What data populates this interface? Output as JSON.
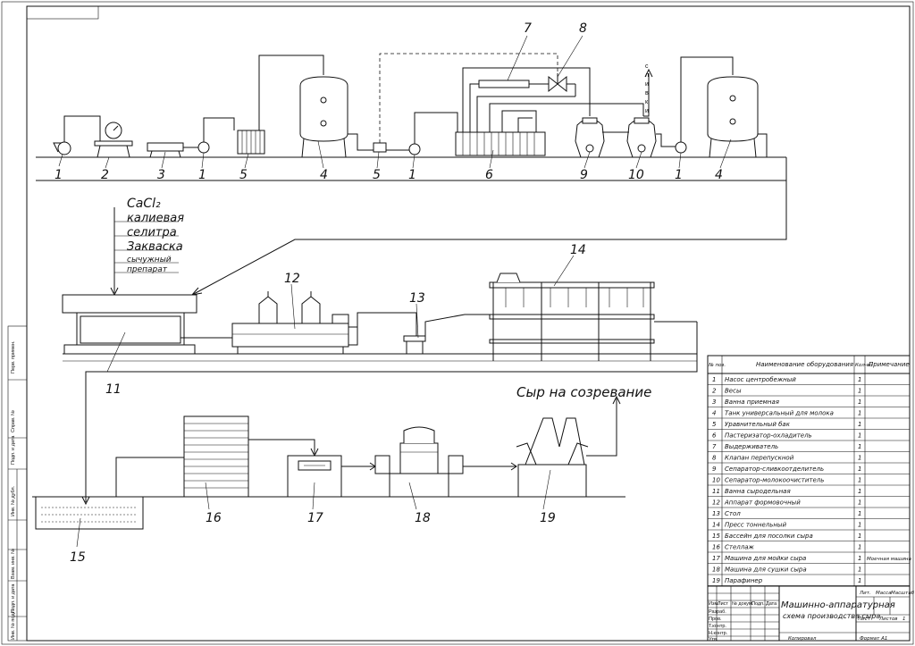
{
  "process_row1": {
    "labels": [
      "1",
      "2",
      "3",
      "1",
      "5",
      "4",
      "5",
      "1",
      "6",
      "9",
      "10",
      "1",
      "4"
    ],
    "top_labels": [
      "7",
      "8"
    ],
    "drain_letters": [
      "с",
      "л",
      "и",
      "в",
      "к",
      "и"
    ]
  },
  "process_row2": {
    "additives": [
      "CaCl₂",
      "калиевая",
      "селитра",
      "Закваска",
      "сычужный",
      "препарат"
    ],
    "labels": [
      "11",
      "12",
      "13",
      "14"
    ]
  },
  "process_row3": {
    "output_label": "Сыр на созревание",
    "labels": [
      "15",
      "16",
      "17",
      "18",
      "19"
    ]
  },
  "spec_table": {
    "header": {
      "pos": "№ поз.",
      "name": "Наименование оборудования",
      "qty": "Кол-во",
      "note": "Примечание"
    },
    "rows": [
      {
        "pos": "1",
        "name": "Насос центробежный",
        "qty": "1",
        "note": ""
      },
      {
        "pos": "2",
        "name": "Весы",
        "qty": "1",
        "note": ""
      },
      {
        "pos": "3",
        "name": "Ванна приемная",
        "qty": "1",
        "note": ""
      },
      {
        "pos": "4",
        "name": "Танк универсальный для молока",
        "qty": "1",
        "note": ""
      },
      {
        "pos": "5",
        "name": "Уравнительный бак",
        "qty": "1",
        "note": ""
      },
      {
        "pos": "6",
        "name": "Пастеризатор-охладитель",
        "qty": "1",
        "note": ""
      },
      {
        "pos": "7",
        "name": "Выдерживатель",
        "qty": "1",
        "note": ""
      },
      {
        "pos": "8",
        "name": "Клапан перепускной",
        "qty": "1",
        "note": ""
      },
      {
        "pos": "9",
        "name": "Сепаратор-сливкоотделитель",
        "qty": "1",
        "note": ""
      },
      {
        "pos": "10",
        "name": "Сепаратор-молокоочиститель",
        "qty": "1",
        "note": ""
      },
      {
        "pos": "11",
        "name": "Ванна сыродельная",
        "qty": "1",
        "note": ""
      },
      {
        "pos": "12",
        "name": "Аппарат формовочный",
        "qty": "1",
        "note": ""
      },
      {
        "pos": "13",
        "name": "Стол",
        "qty": "1",
        "note": ""
      },
      {
        "pos": "14",
        "name": "Пресс тоннельный",
        "qty": "1",
        "note": ""
      },
      {
        "pos": "15",
        "name": "Бассейн для посолки сыра",
        "qty": "1",
        "note": ""
      },
      {
        "pos": "16",
        "name": "Стеллаж",
        "qty": "1",
        "note": ""
      },
      {
        "pos": "17",
        "name": "Машина для мойки сыра",
        "qty": "1",
        "note": "Моечная машина"
      },
      {
        "pos": "18",
        "name": "Машина для сушки сыра",
        "qty": "1",
        "note": ""
      },
      {
        "pos": "19",
        "name": "Парафинер",
        "qty": "1",
        "note": ""
      }
    ]
  },
  "title_block": {
    "title_line1": "Машинно-аппаратурная",
    "title_line2": "схема производства сыра",
    "col_lit": "Лит.",
    "col_mass": "Масса",
    "col_scale": "Масштаб",
    "sheet": "Лист",
    "sheets": "Листов",
    "sheets_count": "1",
    "role_labels": [
      "Изм.",
      "Лист",
      "№ докум.",
      "Подп.",
      "Дата",
      "Разраб.",
      "Пров.",
      "Т.контр.",
      "Н.контр.",
      "Утв."
    ],
    "copied": "Копировал",
    "format": "Формат  А1"
  },
  "side_stamps": [
    "Перв. примен.",
    "Справ. №",
    "Подп. и дата",
    "Инв. № дубл.",
    "Взам. инв. №",
    "Подп. и дата",
    "Инв. № подл."
  ]
}
